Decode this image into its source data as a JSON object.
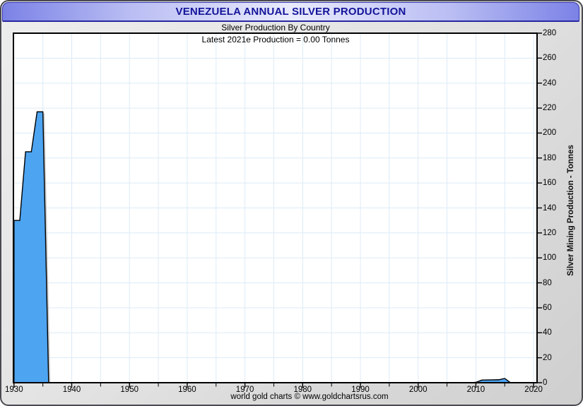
{
  "window": {
    "title": "VENEZUELA ANNUAL SILVER PRODUCTION"
  },
  "chart": {
    "subtitle": "Silver Production By Country",
    "annotation": "Latest 2021e Production = 0.00 Tonnes",
    "y_axis_title": "Silver Mining Production - Tonnes",
    "footer_credit": "world gold charts © www.goldchartsrus.com"
  },
  "chart_data": {
    "type": "area",
    "title": "VENEZUELA ANNUAL SILVER PRODUCTION",
    "subtitle": "Silver Production By Country",
    "annotation": "Latest 2021e Production = 0.00 Tonnes",
    "xlabel": "",
    "ylabel": "Silver Mining Production - Tonnes",
    "xlim": [
      1929.9,
      2020.6
    ],
    "ylim": [
      0,
      280
    ],
    "grid": "on",
    "legend_position": "none",
    "x_major_ticks": [
      1930,
      1940,
      1950,
      1960,
      1970,
      1980,
      1990,
      2000,
      2010,
      2020
    ],
    "x_minor_ticks": [
      1935,
      1945,
      1955,
      1965,
      1975,
      1985,
      1995,
      2005,
      2015
    ],
    "y_ticks": [
      0,
      20,
      40,
      60,
      80,
      100,
      120,
      140,
      160,
      180,
      200,
      220,
      240,
      260,
      280
    ],
    "series": [
      {
        "name": "Venezuela annual silver production (tonnes)",
        "points_year_tonnes": [
          [
            1930,
            130
          ],
          [
            1931,
            130
          ],
          [
            1932,
            185
          ],
          [
            1933,
            185
          ],
          [
            1934,
            217
          ],
          [
            1935,
            217
          ],
          [
            1936,
            0
          ],
          [
            2009,
            0
          ],
          [
            2010,
            0.3
          ],
          [
            2011,
            2.1
          ],
          [
            2012,
            2.2
          ],
          [
            2013,
            2.3
          ],
          [
            2014,
            2.4
          ],
          [
            2015,
            3.4
          ],
          [
            2016,
            0
          ],
          [
            2021,
            0
          ]
        ]
      }
    ],
    "colors": {
      "area_fill": "#4da4f1",
      "area_outline": "#000000",
      "gridline": "#dcebf7",
      "shadow": "#999999",
      "plot_background": "#ffffff",
      "plot_border": "#000000",
      "title_text": "#14149a"
    }
  }
}
